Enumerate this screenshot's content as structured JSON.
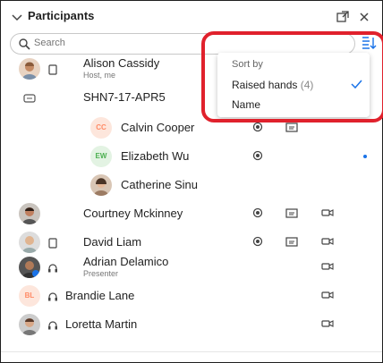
{
  "header": {
    "title": "Participants",
    "collapse_icon": "chevron-down-icon",
    "popout_icon": "popout-icon",
    "close_icon": "close-icon"
  },
  "search": {
    "placeholder": "Search",
    "value": "",
    "icon": "search-icon"
  },
  "sort_button": {
    "icon": "sort-list-icon",
    "accent_color": "#1a73e8"
  },
  "sort_menu": {
    "heading": "Sort by",
    "options": [
      {
        "label": "Raised hands",
        "count": "(4)",
        "selected": true
      },
      {
        "label": "Name",
        "selected": false
      }
    ],
    "check_color": "#1a73e8"
  },
  "highlight_color": "#e0212c",
  "participants": [
    {
      "name": "Alison Cassidy",
      "role": "Host, me",
      "device": "phone-icon"
    },
    {
      "name": "SHN7-17-APR5",
      "device": "room-device-icon"
    },
    {
      "name": "Calvin Cooper",
      "initials": "CC",
      "initials_color": "#ff8a65"
    },
    {
      "name": "Elizabeth Wu",
      "initials": "EW",
      "initials_color": "#4caf50"
    },
    {
      "name": "Catherine Sinu"
    },
    {
      "name": "Courtney Mckinney"
    },
    {
      "name": "David Liam",
      "device": "phone-icon"
    },
    {
      "name": "Adrian Delamico",
      "role": "Presenter",
      "device": "headset-icon"
    },
    {
      "name": "Brandie Lane",
      "initials": "BL",
      "initials_color": "#ff8a65",
      "device": "headset-icon"
    },
    {
      "name": "Loretta Martin",
      "device": "headset-icon"
    }
  ]
}
